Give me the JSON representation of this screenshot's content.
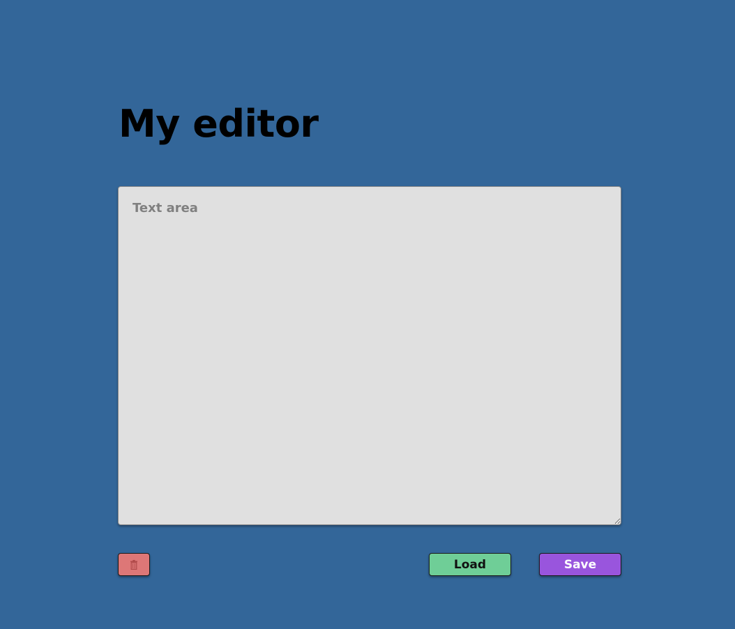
{
  "page": {
    "title": "My editor"
  },
  "editor": {
    "value": "",
    "placeholder": "Text area"
  },
  "buttons": {
    "delete_icon": "trash-icon",
    "load_label": "Load",
    "save_label": "Save"
  },
  "colors": {
    "background": "#336699",
    "textarea": "#e0e0e0",
    "delete": "#dd7777",
    "load": "#6fce97",
    "save": "#9955dd"
  }
}
